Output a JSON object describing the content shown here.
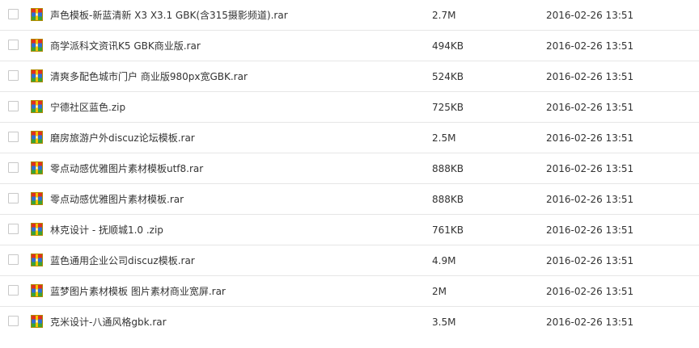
{
  "colors": {
    "text": "#333333",
    "row_border": "#e6e6e6",
    "checkbox_border": "#c8c8c8",
    "archive_icon_red": "#e0301e",
    "archive_icon_blue": "#2f6fd6",
    "archive_icon_green": "#3aa335",
    "archive_icon_yellow": "#f5c400"
  },
  "files": [
    {
      "icon": "archive-icon",
      "name": "声色模板-新蓝清新 X3 X3.1 GBK(含315摄影频道).rar",
      "size": "2.7M",
      "date": "2016-02-26 13:51"
    },
    {
      "icon": "archive-icon",
      "name": "商学派科文资讯K5 GBK商业版.rar",
      "size": "494KB",
      "date": "2016-02-26 13:51"
    },
    {
      "icon": "archive-icon",
      "name": "清爽多配色城市门户 商业版980px宽GBK.rar",
      "size": "524KB",
      "date": "2016-02-26 13:51"
    },
    {
      "icon": "archive-icon",
      "name": "宁德社区蓝色.zip",
      "size": "725KB",
      "date": "2016-02-26 13:51"
    },
    {
      "icon": "archive-icon",
      "name": "磨房旅游户外discuz论坛模板.rar",
      "size": "2.5M",
      "date": "2016-02-26 13:51"
    },
    {
      "icon": "archive-icon",
      "name": "零点动感优雅图片素材模板utf8.rar",
      "size": "888KB",
      "date": "2016-02-26 13:51"
    },
    {
      "icon": "archive-icon",
      "name": "零点动感优雅图片素材模板.rar",
      "size": "888KB",
      "date": "2016-02-26 13:51"
    },
    {
      "icon": "archive-icon",
      "name": "林克设计 - 抚顺城1.0 .zip",
      "size": "761KB",
      "date": "2016-02-26 13:51"
    },
    {
      "icon": "archive-icon",
      "name": "蓝色通用企业公司discuz模板.rar",
      "size": "4.9M",
      "date": "2016-02-26 13:51"
    },
    {
      "icon": "archive-icon",
      "name": "蓝梦图片素材模板 图片素材商业宽屏.rar",
      "size": "2M",
      "date": "2016-02-26 13:51"
    },
    {
      "icon": "archive-icon",
      "name": "克米设计-八通风格gbk.rar",
      "size": "3.5M",
      "date": "2016-02-26 13:51"
    }
  ]
}
